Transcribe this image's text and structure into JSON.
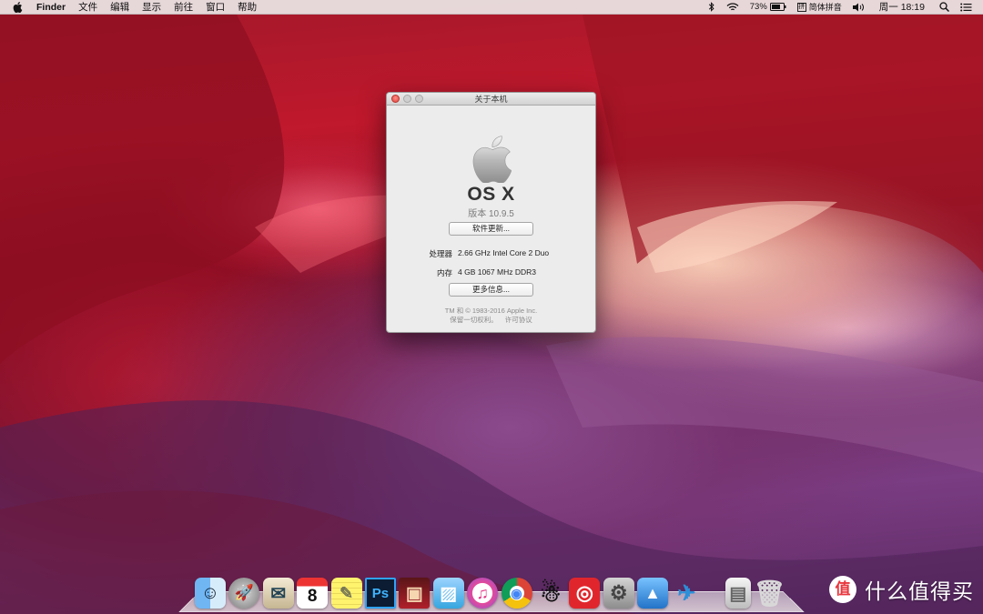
{
  "menubar": {
    "app_name": "Finder",
    "menus": [
      "文件",
      "编辑",
      "显示",
      "前往",
      "窗口",
      "帮助"
    ],
    "status": {
      "battery_percent": "73%",
      "input_method": "简体拼音",
      "input_method_glyph": "拼",
      "clock": "周一 18:19"
    }
  },
  "about_window": {
    "title": "关于本机",
    "os_name": "OS X",
    "version": "版本 10.9.5",
    "software_update_button": "软件更新...",
    "processor_label": "处理器",
    "processor_value": "2.66 GHz Intel Core 2 Duo",
    "memory_label": "内存",
    "memory_value": "4 GB 1067 MHz DDR3",
    "more_info_button": "更多信息...",
    "copyright": "TM 和 © 1983-2016 Apple Inc.",
    "rights": "保留一切权利。",
    "license_link": "许可协议"
  },
  "dock": {
    "items": [
      {
        "name": "finder-icon",
        "glyph": "☺"
      },
      {
        "name": "launchpad-icon",
        "glyph": "🚀"
      },
      {
        "name": "mail-icon",
        "glyph": "✉"
      },
      {
        "name": "calendar-icon",
        "glyph": "8"
      },
      {
        "name": "notes-icon",
        "glyph": "✎"
      },
      {
        "name": "photoshop-icon",
        "glyph": "Ps"
      },
      {
        "name": "photo-booth-icon",
        "glyph": "▣"
      },
      {
        "name": "iphoto-icon",
        "glyph": "▨"
      },
      {
        "name": "itunes-icon",
        "glyph": "♫"
      },
      {
        "name": "chrome-icon",
        "glyph": "◉"
      },
      {
        "name": "qq-icon",
        "glyph": "☃"
      },
      {
        "name": "netease-music-icon",
        "glyph": "◎"
      },
      {
        "name": "system-preferences-icon",
        "glyph": "⚙"
      },
      {
        "name": "keynote-icon",
        "glyph": "▲"
      },
      {
        "name": "bird-app-icon",
        "glyph": "✈"
      }
    ],
    "trailing": [
      {
        "name": "documents-stack-icon",
        "glyph": "▤"
      },
      {
        "name": "trash-icon",
        "glyph": "🗑"
      }
    ]
  },
  "watermark": {
    "text": "什么值得买",
    "glyph": "值"
  },
  "colors": {
    "menubar_bg": "#ece8e8",
    "window_bg": "#ececec",
    "close_button": "#e0443c",
    "watermark_bg": "#ffffff"
  }
}
